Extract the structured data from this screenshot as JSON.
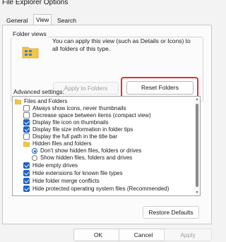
{
  "window": {
    "title": "File Explorer Options"
  },
  "tabs": [
    {
      "label": "General",
      "active": false
    },
    {
      "label": "View",
      "active": true
    },
    {
      "label": "Search",
      "active": false
    }
  ],
  "folder_views": {
    "title": "Folder views",
    "description": "You can apply this view (such as Details or Icons) to all folders of this type.",
    "apply_button": "Apply to Folders",
    "reset_button": "Reset Folders"
  },
  "advanced": {
    "label": "Advanced settings:",
    "items": [
      {
        "kind": "folder",
        "label": "Files and Folders",
        "indent": 0
      },
      {
        "kind": "checkbox",
        "label": "Always show icons, never thumbnails",
        "checked": false,
        "indent": 1
      },
      {
        "kind": "checkbox",
        "label": "Decrease space between items (compact view)",
        "checked": false,
        "indent": 1
      },
      {
        "kind": "checkbox",
        "label": "Display file icon on thumbnails",
        "checked": true,
        "indent": 1
      },
      {
        "kind": "checkbox",
        "label": "Display file size information in folder tips",
        "checked": true,
        "indent": 1
      },
      {
        "kind": "checkbox",
        "label": "Display the full path in the title bar",
        "checked": false,
        "indent": 1
      },
      {
        "kind": "folder",
        "label": "Hidden files and folders",
        "indent": 1
      },
      {
        "kind": "radio",
        "label": "Don't show hidden files, folders or drives",
        "checked": true,
        "indent": 2
      },
      {
        "kind": "radio",
        "label": "Show hidden files, folders and drives",
        "checked": false,
        "indent": 2
      },
      {
        "kind": "checkbox",
        "label": "Hide empty drives",
        "checked": true,
        "indent": 1
      },
      {
        "kind": "checkbox",
        "label": "Hide extensions for known file types",
        "checked": true,
        "indent": 1
      },
      {
        "kind": "checkbox",
        "label": "Hide folder merge conflicts",
        "checked": true,
        "indent": 1
      },
      {
        "kind": "checkbox",
        "label": "Hide protected operating system files (Recommended)",
        "checked": true,
        "indent": 1
      }
    ]
  },
  "restore_button": "Restore Defaults",
  "footer": {
    "ok": "OK",
    "cancel": "Cancel",
    "apply": "Apply"
  },
  "colors": {
    "accent": "#1e63c4",
    "highlight": "#d9333a"
  }
}
